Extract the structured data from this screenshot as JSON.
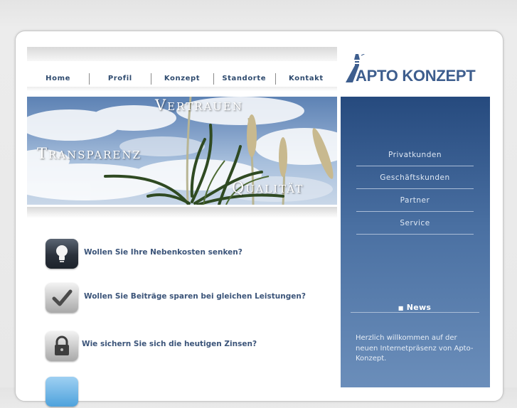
{
  "nav": {
    "items": [
      "Home",
      "Profil",
      "Konzept",
      "Standorte",
      "Kontakt"
    ]
  },
  "logo": {
    "text": "APTO KONZEPT"
  },
  "banner": {
    "words": [
      "Vertrauen",
      "Transparenz",
      "Qualität"
    ]
  },
  "features": [
    {
      "text": "Wollen Sie Ihre Nebenkosten senken?",
      "icon": "lightbulb-icon"
    },
    {
      "text": "Wollen Sie Beiträge sparen bei gleichen Leistungen?",
      "icon": "checkmark-icon"
    },
    {
      "text": "Wie sichern Sie sich die heutigen Zinsen?",
      "icon": "lock-icon"
    }
  ],
  "sidebar": {
    "items": [
      "Privatkunden",
      "Geschäftskunden",
      "Partner",
      "Service"
    ],
    "news_title": "News",
    "news_text": "Herzlich willkommen auf der neuen Internetpräsenz von Apto-Konzept."
  },
  "colors": {
    "nav_text": "#2e4a6e",
    "sidebar_top": "#264a7e",
    "sidebar_bottom": "#6b8eba",
    "logo": "#3e5e8e"
  }
}
